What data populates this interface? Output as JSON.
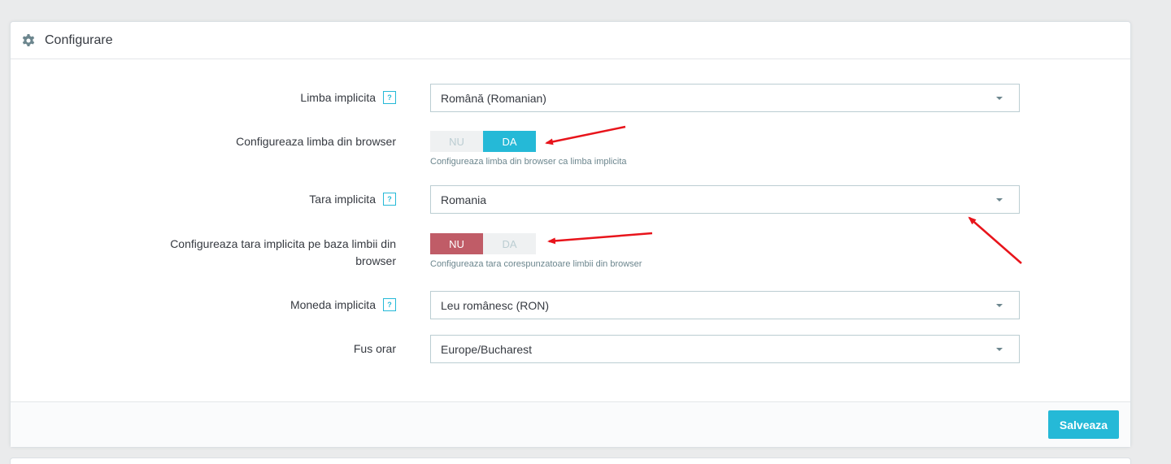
{
  "panel": {
    "title": "Configurare",
    "icon": "gear-icon"
  },
  "fields": {
    "default_language": {
      "label": "Limba implicita",
      "value": "Română (Romanian)"
    },
    "browser_language": {
      "label": "Configureaza limba din browser",
      "off_label": "NU",
      "on_label": "DA",
      "selected": "DA",
      "hint": "Configureaza limba din browser ca limba implicita"
    },
    "default_country": {
      "label": "Tara implicita",
      "value": "Romania"
    },
    "browser_country": {
      "label": "Configureaza tara implicita pe baza limbii din browser",
      "off_label": "NU",
      "on_label": "DA",
      "selected": "NU",
      "hint": "Configureaza tara corespunzatoare limbii din browser"
    },
    "default_currency": {
      "label": "Moneda implicita",
      "value": "Leu românesc (RON)"
    },
    "timezone": {
      "label": "Fus orar",
      "value": "Europe/Bucharest"
    }
  },
  "footer": {
    "save_label": "Salveaza"
  },
  "colors": {
    "accent": "#25b9d7",
    "danger": "#c05c67",
    "annotation_arrow": "#e8141b"
  }
}
